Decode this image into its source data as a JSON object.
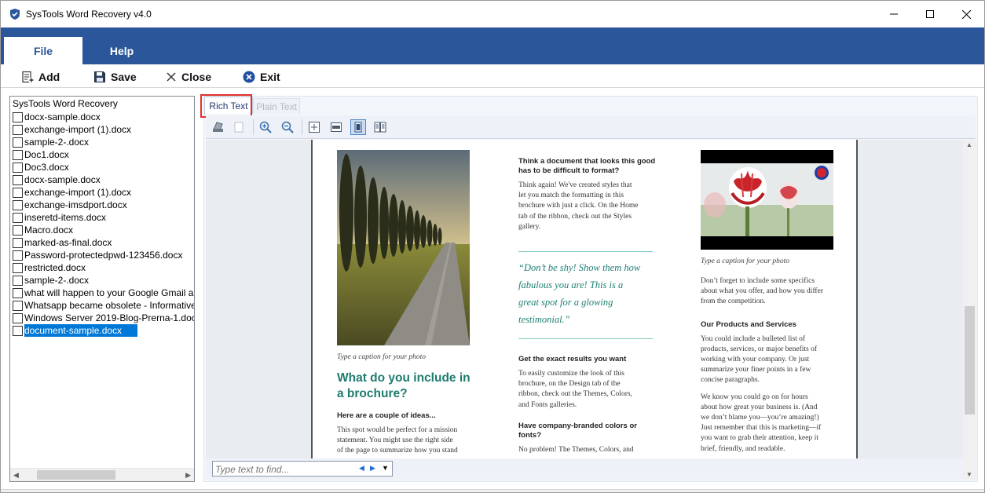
{
  "window": {
    "title": "SysTools Word Recovery v4.0"
  },
  "menu": {
    "tabs": [
      {
        "label": "File",
        "active": true
      },
      {
        "label": "Help",
        "active": false
      }
    ]
  },
  "ribbon": {
    "add_label": "Add",
    "save_label": "Save",
    "close_label": "Close",
    "exit_label": "Exit"
  },
  "tree": {
    "root_label": "SysTools Word Recovery",
    "items": [
      {
        "label": "docx-sample.docx"
      },
      {
        "label": "exchange-import (1).docx"
      },
      {
        "label": "sample-2-.docx"
      },
      {
        "label": "Doc1.docx"
      },
      {
        "label": "Doc3.docx"
      },
      {
        "label": "docx-sample.docx"
      },
      {
        "label": "exchange-import (1).docx"
      },
      {
        "label": "exchange-imsdport.docx"
      },
      {
        "label": "inseretd-items.docx"
      },
      {
        "label": "Macro.docx"
      },
      {
        "label": "marked-as-final.docx"
      },
      {
        "label": "Password-protectedpwd-123456.docx"
      },
      {
        "label": "restricted.docx"
      },
      {
        "label": "sample-2-.docx"
      },
      {
        "label": "what will happen to your Google Gmail a"
      },
      {
        "label": "Whatsapp became obsolete - Informative"
      },
      {
        "label": "Windows Server 2019-Blog-Prerna-1.doc"
      },
      {
        "label": "document-sample.docx",
        "selected": true
      }
    ]
  },
  "viewer": {
    "tabs": {
      "rich_text": "Rich Text",
      "plain_text": "Plain Text"
    },
    "find": {
      "placeholder": "Type text to find..."
    }
  },
  "document": {
    "col1": {
      "caption": "Type a caption for your photo",
      "heading": "What do you include in a brochure?",
      "subheading": "Here are a couple of ideas...",
      "para_l1": "This spot would be perfect for a mission",
      "para_l2": "statement. You might use the right side",
      "para_l3": "of the page to summarize how you stand"
    },
    "col2": {
      "h1_l1": "Think a document that looks this good",
      "h1_l2": "has to be difficult to format?",
      "p1_l1": "Think again! We've created styles that",
      "p1_l2": "let you match the formatting in this",
      "p1_l3": "brochure with just a click. On the Home",
      "p1_l4": "tab of the ribbon, check out the Styles",
      "p1_l5": "gallery.",
      "quote_l1": "“Don’t be shy! Show them how",
      "quote_l2": "fabulous you are! This is a",
      "quote_l3": "great spot for a glowing",
      "quote_l4": "testimonial.”",
      "h2": "Get the exact results you want",
      "p2_l1": "To easily customize the look of this",
      "p2_l2": "brochure, on the Design tab of the",
      "p2_l3": "ribbon, check out the Themes, Colors,",
      "p2_l4": "and Fonts galleries.",
      "h3_l1": "Have company-branded colors or",
      "h3_l2": "fonts?",
      "p3_l1": "No problem! The Themes, Colors, and"
    },
    "col3": {
      "caption": "Type a caption for your photo",
      "p1_l1": "Don’t forget to include some specifics",
      "p1_l2": "about what you offer, and how you differ",
      "p1_l3": "from the competition.",
      "h1": "Our Products and Services",
      "p2_l1": "You could include a bulleted list of",
      "p2_l2": "products, services, or major benefits of",
      "p2_l3": "working with your company. Or just",
      "p2_l4": "summarize your finer points in a few",
      "p2_l5": "concise paragraphs.",
      "p3_l1": "We know you could go on for hours",
      "p3_l2": "about how great your business is. (And",
      "p3_l3": "we don’t blame you—you’re amazing!)",
      "p3_l4": "Just remember that this is marketing—if",
      "p3_l5": "you want to grab their attention, keep it",
      "p3_l6": "brief, friendly, and readable."
    }
  },
  "colors": {
    "accent_blue": "#2b579a",
    "selection_blue": "#0078d7",
    "doc_teal": "#1e7b6f",
    "highlight_red": "#e0312b"
  }
}
